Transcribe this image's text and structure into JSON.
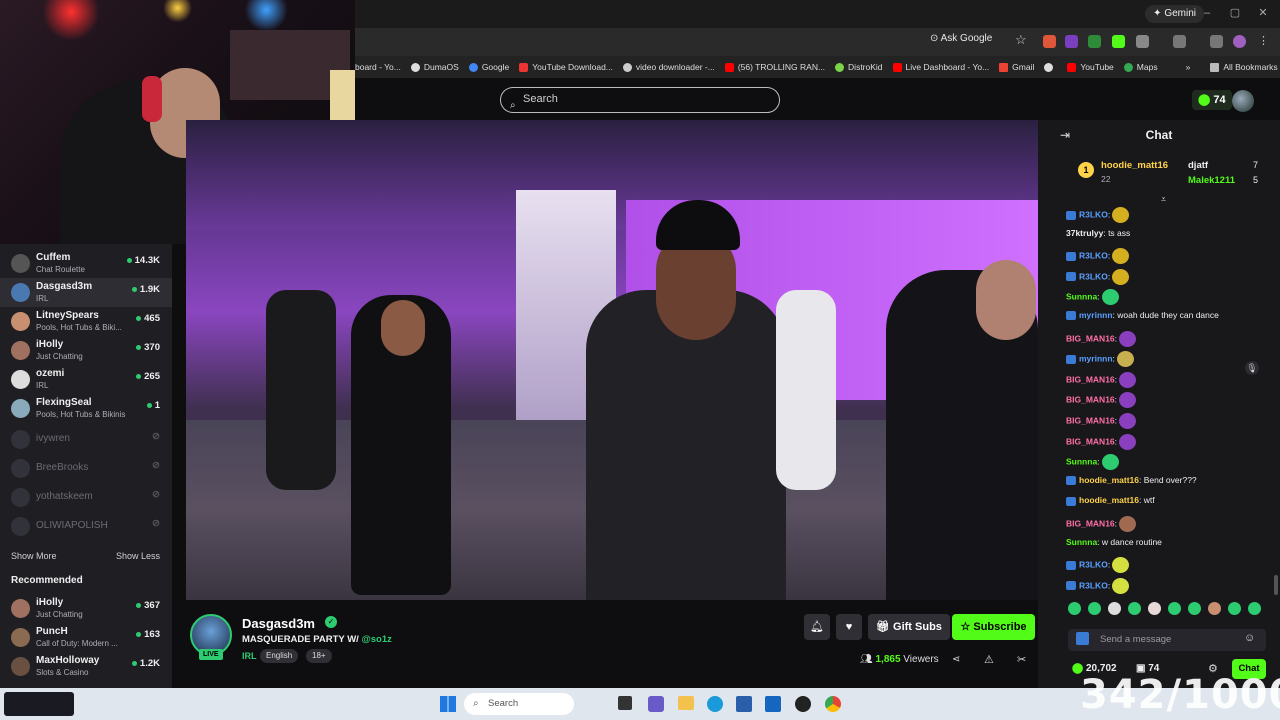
{
  "browser": {
    "gemini_label": "Gemini",
    "ask_google": "Ask Google",
    "bookmarks": [
      "board - Yo...",
      "DumaOS",
      "Google",
      "YouTube Download...",
      "video downloader -...",
      "(56) TROLLING RAN...",
      "DistroKid",
      "Live Dashboard - Yo...",
      "Gmail",
      "YouTube",
      "Maps"
    ],
    "all_bookmarks": "All Bookmarks"
  },
  "header": {
    "search_placeholder": "Search",
    "points": "74"
  },
  "sidebar": {
    "following": [
      {
        "name": "Cuffem",
        "category": "Chat Roulette",
        "viewers": "14.3K"
      },
      {
        "name": "Dasgasd3m",
        "category": "IRL",
        "viewers": "1.9K"
      },
      {
        "name": "LitneySpears",
        "category": "Pools, Hot Tubs & Biki...",
        "viewers": "465"
      },
      {
        "name": "iHolly",
        "category": "Just Chatting",
        "viewers": "370"
      },
      {
        "name": "ozemi",
        "category": "IRL",
        "viewers": "265"
      },
      {
        "name": "FlexingSeal",
        "category": "Pools, Hot Tubs & Bikinis",
        "viewers": "1"
      }
    ],
    "offline": [
      "ivywren",
      "BreeBrooks",
      "yothatskeem",
      "OLIWIAPOLISH"
    ],
    "show_more": "Show More",
    "show_less": "Show Less",
    "recommended_title": "Recommended",
    "recommended": [
      {
        "name": "iHolly",
        "category": "Just Chatting",
        "viewers": "367"
      },
      {
        "name": "PuncH",
        "category": "Call of Duty: Modern ...",
        "viewers": "163"
      },
      {
        "name": "MaxHolloway",
        "category": "Slots & Casino",
        "viewers": "1.2K"
      }
    ]
  },
  "stream": {
    "streamer": "Dasgasd3m",
    "live_label": "LIVE",
    "title": "MASQUERADE PARTY W/ ",
    "title_mention": "@so1z",
    "category": "IRL",
    "tags": [
      "English",
      "18+"
    ],
    "gift_subs": "Gift Subs",
    "subscribe": "Subscribe",
    "viewers_count": "1,865",
    "viewers_label": " Viewers"
  },
  "chat": {
    "title": "Chat",
    "leaderboard": [
      {
        "rank": "1",
        "name": "hoodie_matt16",
        "count": "22"
      },
      {
        "name": "djatf",
        "count": "7"
      },
      {
        "name": "Malek1211",
        "count": "5"
      }
    ],
    "messages": [
      {
        "user": "R3LKO",
        "text": ":",
        "color": "#5aa0ff",
        "emote": "#d4b020"
      },
      {
        "user": "37ktrulyy",
        "text": ": ts ass",
        "color": "#efeff1",
        "emote": ""
      },
      {
        "user": "R3LKO",
        "text": ":",
        "color": "#5aa0ff",
        "emote": "#d4b020"
      },
      {
        "user": "R3LKO",
        "text": ":",
        "color": "#5aa0ff",
        "emote": "#d4b020"
      },
      {
        "user": "Sunnna",
        "text": ":",
        "color": "#53fc18",
        "emote": "#2ecc71"
      },
      {
        "user": "myrinnn",
        "text": ": woah dude they can dance",
        "color": "#5aa0ff",
        "emote": ""
      },
      {
        "user": "BIG_MAN16",
        "text": ":",
        "color": "#ff6fa6",
        "emote": "#8a3fbf"
      },
      {
        "user": "myrinnn",
        "text": ":",
        "color": "#5aa0ff",
        "emote": "#c8b050"
      },
      {
        "user": "BIG_MAN16",
        "text": ":",
        "color": "#ff6fa6",
        "emote": "#8a3fbf"
      },
      {
        "user": "BIG_MAN16",
        "text": ":",
        "color": "#ff6fa6",
        "emote": "#8a3fbf"
      },
      {
        "user": "BIG_MAN16",
        "text": ":",
        "color": "#ff6fa6",
        "emote": "#8a3fbf"
      },
      {
        "user": "BIG_MAN16",
        "text": ":",
        "color": "#ff6fa6",
        "emote": "#8a3fbf"
      },
      {
        "user": "Sunnna",
        "text": ":",
        "color": "#53fc18",
        "emote": "#2ecc71"
      },
      {
        "user": "hoodie_matt16",
        "text": ": Bend over???",
        "color": "#ffd24a",
        "emote": ""
      },
      {
        "user": "hoodie_matt16",
        "text": ": wtf",
        "color": "#ffd24a",
        "emote": ""
      },
      {
        "user": "BIG_MAN16",
        "text": ":",
        "color": "#ff6fa6",
        "emote": "#a06a50"
      },
      {
        "user": "Sunnna",
        "text": ": w dance routine",
        "color": "#53fc18",
        "emote": ""
      },
      {
        "user": "R3LKO",
        "text": ":",
        "color": "#5aa0ff",
        "emote": "#d4e040"
      },
      {
        "user": "R3LKO",
        "text": ":",
        "color": "#5aa0ff",
        "emote": "#d4e040"
      }
    ],
    "input_placeholder": "Send a message",
    "points_total": "20,702",
    "gifts": "74",
    "chat_button": "Chat"
  },
  "taskbar": {
    "search": "Search"
  },
  "overlay": {
    "counter": "342/1000"
  },
  "colors": {
    "kick_green": "#53fc18",
    "live_green": "#2ecc71"
  }
}
